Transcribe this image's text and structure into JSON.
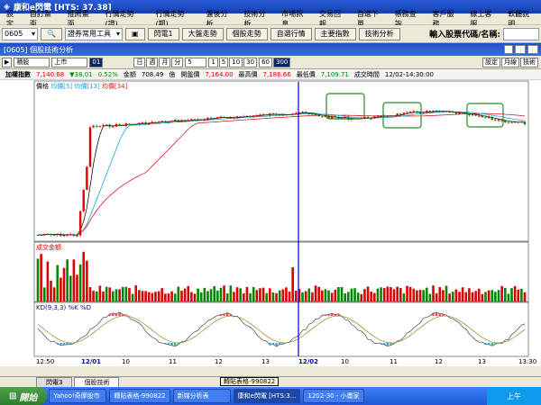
{
  "titlebar": {
    "title": "康和e閃電 [HTS: 37.38]"
  },
  "menu": [
    "設定",
    "自訂畫面",
    "推薦畫面",
    "行情走勢(證)",
    "行情走勢(期)",
    "盤後分析",
    "技術分析",
    "市場訊息",
    "交易回報",
    "自選下單",
    "帳務查詢",
    "客戶服務",
    "線上客服",
    "軟體說明"
  ],
  "toolbar": {
    "stock_code": "0605",
    "tool_select": "證券常用工具",
    "buttons": [
      "閃電1",
      "大盤走勢",
      "個股走勢",
      "自選行情",
      "主要指數",
      "技術分析"
    ],
    "query_label": "輸入股票代碼/名稱:"
  },
  "window": {
    "title": "[0605] 個股技術分析"
  },
  "controls": {
    "mode": "積股",
    "market": "上市",
    "period_select": "01",
    "periods": [
      "日",
      "週",
      "月",
      "分"
    ],
    "num": "5",
    "intervals": [
      "1",
      "5",
      "10",
      "30"
    ],
    "intervals2": [
      "60",
      "300"
    ],
    "right_buttons": [
      "設定",
      "月線",
      "技術"
    ]
  },
  "quote": {
    "name": "加權指數",
    "price": "7,140.68",
    "change": "▼38.01",
    "pct": "0.52%",
    "vol_label": "金額",
    "vol": "708.49",
    "vol_unit": "億",
    "open_label": "開盤價",
    "open": "7,164.00",
    "high_label": "最高價",
    "high": "7,186.66",
    "low_label": "最低價",
    "low": "7,109.71",
    "time_label": "成交時間",
    "time": "12/02-14:30:00"
  },
  "chart_data": {
    "type": "candlestick",
    "price_legend": [
      "價格",
      "均價[5]",
      "均價[13]",
      "均價[34]"
    ],
    "volume_legend": "成交金額",
    "kd_legend": "KD(9,3,3) %K %D",
    "x_ticks": [
      "12:50",
      "12/01",
      "10",
      "11",
      "12",
      "13",
      "12/02",
      "10",
      "11",
      "12",
      "13",
      "13:30"
    ],
    "marker_time": "12/02",
    "colors": {
      "ma5": "#111111",
      "ma13": "#1fa0e0",
      "ma34": "#d02020",
      "up": "#e00000",
      "down": "#008000",
      "cursor": "#0000cc"
    }
  },
  "tabs": {
    "items": [
      "閃電3",
      "個股技術"
    ],
    "tooltip": "轉貼表格-990822"
  },
  "taskbar": {
    "start": "開始",
    "tasks": [
      "Yahoo!奇摩股市",
      "轉貼表格-990822",
      "新媒分析表",
      "康和e閃電 [HTS:3...",
      "1202-30 - 小畫家"
    ],
    "tray": "上午"
  }
}
